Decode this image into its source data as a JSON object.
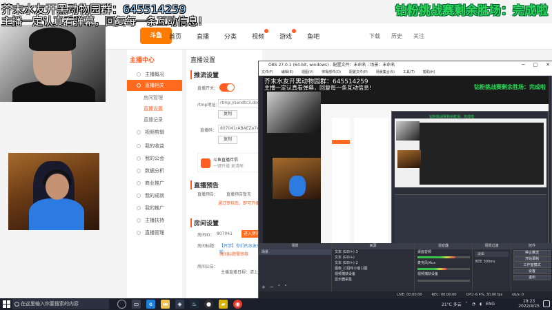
{
  "overlay": {
    "line1_prefix": "芥末水友开黑动物园群：",
    "line1_number": "645514259",
    "line2": "主播一定认真看弹幕，回复每一条互动信息!",
    "right": "钻粉挑战赛剩余胜场：完成啦"
  },
  "site": {
    "logo": "斗鱼",
    "nav": [
      "首页",
      "直播",
      "分类",
      "视频",
      "游戏",
      "鱼吧"
    ],
    "header_right": [
      "下载",
      "历史",
      "关注"
    ]
  },
  "sidebar": {
    "title": "主播中心",
    "items": [
      {
        "label": "主播概况"
      },
      {
        "label": "直播相关"
      },
      {
        "label": "房间管理"
      },
      {
        "label": "直播设置"
      },
      {
        "label": "直播记录"
      },
      {
        "label": "视频剪辑"
      },
      {
        "label": "我的收益"
      },
      {
        "label": "我的公会"
      },
      {
        "label": "数据分析"
      },
      {
        "label": "商业推广"
      },
      {
        "label": "我的成就"
      },
      {
        "label": "我的推广"
      },
      {
        "label": "主播扶持"
      },
      {
        "label": "直播管理"
      }
    ]
  },
  "content": {
    "title": "直播设置",
    "section_push": "推流设置",
    "live_switch_label": "直播开关：",
    "rtmp_label": "rtmp地址：",
    "rtmp_value": "rtmp://sendtc3.douyu.com/live",
    "copy_label": "复制",
    "key_label": "直播码：",
    "key_value": "807041rABAEZe7e",
    "promo_line1": "斗鱼直播伴侣",
    "promo_line2": "一键开播 更清晰",
    "section_preview": "直播预告",
    "preview_label": "直播预告：",
    "preview_value": "直播预告暂无",
    "preview_link": "通过审核后，即可开播",
    "section_room": "房间设置",
    "room_id_label": "房间ID：",
    "room_id_value": "807041",
    "room_btn": "进入房间",
    "room_name_label": "房间标题：",
    "room_name_value": "【开学】你们的水友来啦",
    "room_note": "房间标题需审核",
    "notice_label": "房间公告：",
    "notice_value": "主播直播日程：",
    "notice_extra": "请上"
  },
  "obs": {
    "title": "OBS 27.0.1 (64-bit, windows) - 配置文件：未命名 - 场景：未命名",
    "menu": [
      "文件(F)",
      "编辑(E)",
      "视图(V)",
      "停靠部件(D)",
      "配置文件(P)",
      "场景集合(S)",
      "工具(T)",
      "帮助(H)"
    ],
    "docks": {
      "scenes": {
        "title": "场景",
        "items": [
          "场景"
        ]
      },
      "sources": {
        "title": "来源",
        "items": [
          "文本 (GDI+) 3",
          "文本 (GDI+)",
          "文本 (GDI+) 2",
          "图像_打招呼小窗口图",
          "视频捕获设备",
          "显示器采集"
        ]
      },
      "mixer": {
        "title": "混音器",
        "items": [
          "桌面音频",
          "麦克风/Aux",
          "视频捕获设备"
        ],
        "levels": [
          0.72,
          0.55,
          0.0
        ]
      },
      "transitions": {
        "title": "场景过渡",
        "type": "淡出",
        "duration_label": "时长",
        "duration": "300ms"
      },
      "controls": {
        "title": "控件",
        "buttons": [
          "停止推流",
          "开始录制",
          "工作室模式",
          "设置",
          "退出"
        ]
      }
    },
    "status": [
      "LIVE: 00:00:00",
      "REC: 00:00:00",
      "CPU: 6.4%, 30.00 fps",
      "kb/s: 0"
    ]
  },
  "taskbar": {
    "search": "在这里输入你要搜索的内容",
    "weather": "21°C 多云",
    "lang": "ENG",
    "time": "19:23",
    "date": "2022/4/25"
  }
}
